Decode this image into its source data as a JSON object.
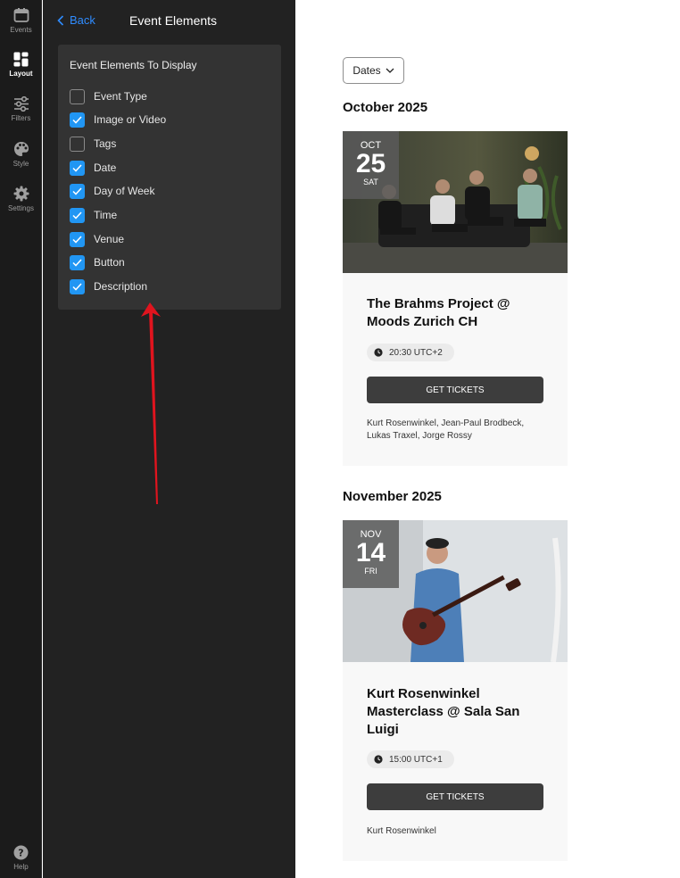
{
  "rail": {
    "items": [
      {
        "label": "Events",
        "icon": "calendar-icon"
      },
      {
        "label": "Layout",
        "icon": "layout-icon",
        "active": true
      },
      {
        "label": "Filters",
        "icon": "sliders-icon"
      },
      {
        "label": "Style",
        "icon": "palette-icon"
      },
      {
        "label": "Settings",
        "icon": "gear-icon"
      }
    ],
    "help": {
      "label": "Help",
      "icon": "help-icon"
    }
  },
  "panel": {
    "back_label": "Back",
    "title": "Event Elements",
    "card_title": "Event Elements To Display",
    "options": [
      {
        "label": "Event Type",
        "checked": false
      },
      {
        "label": "Image or Video",
        "checked": true
      },
      {
        "label": "Tags",
        "checked": false
      },
      {
        "label": "Date",
        "checked": true
      },
      {
        "label": "Day of Week",
        "checked": true
      },
      {
        "label": "Time",
        "checked": true
      },
      {
        "label": "Venue",
        "checked": true
      },
      {
        "label": "Button",
        "checked": true
      },
      {
        "label": "Description",
        "checked": true
      }
    ]
  },
  "preview": {
    "dates_button": "Dates",
    "groups": [
      {
        "month": "October 2025",
        "event": {
          "date_month": "OCT",
          "date_day": "25",
          "date_weekday": "SAT",
          "title": "The Brahms Project @ Moods Zurich CH",
          "time": "20:30 UTC+2",
          "button": "GET TICKETS",
          "description": "Kurt Rosenwinkel, Jean-Paul Brodbeck, Lukas Traxel, Jorge Rossy"
        }
      },
      {
        "month": "November 2025",
        "event": {
          "date_month": "NOV",
          "date_day": "14",
          "date_weekday": "FRI",
          "title": "Kurt Rosenwinkel Masterclass @ Sala San Luigi",
          "time": "15:00 UTC+1",
          "button": "GET TICKETS",
          "description": "Kurt Rosenwinkel"
        }
      }
    ]
  },
  "colors": {
    "accent": "#2196f3",
    "link": "#2f8cff",
    "annotation_arrow": "#e0141e",
    "button": "#3d3d3d"
  }
}
